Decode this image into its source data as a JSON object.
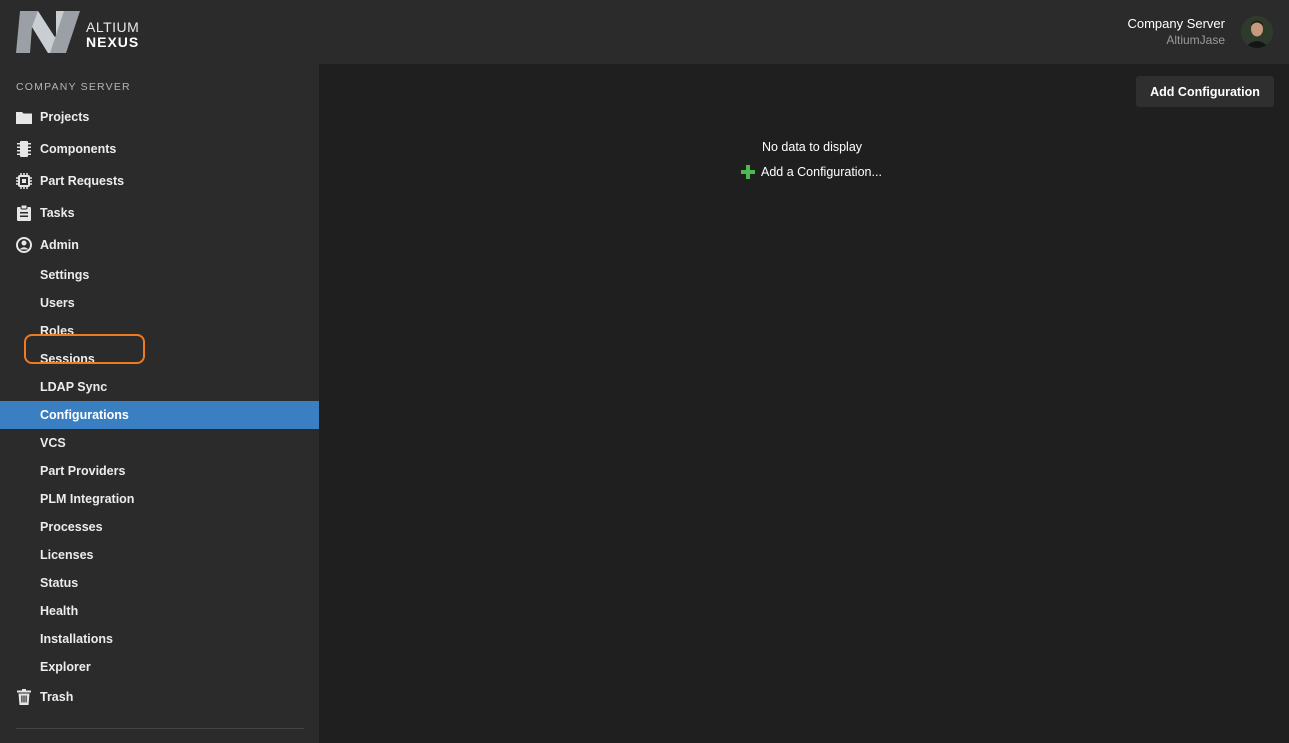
{
  "header": {
    "logo_line1": "ALTIUM",
    "logo_line2": "NEXUS",
    "server_name": "Company Server",
    "user_name": "AltiumJase"
  },
  "sidebar": {
    "section_label": "COMPANY SERVER",
    "items": [
      {
        "label": "Projects",
        "icon": "folder-icon"
      },
      {
        "label": "Components",
        "icon": "component-icon"
      },
      {
        "label": "Part Requests",
        "icon": "chip-icon"
      },
      {
        "label": "Tasks",
        "icon": "clipboard-icon"
      },
      {
        "label": "Admin",
        "icon": "user-circle-icon"
      },
      {
        "label": "Settings"
      },
      {
        "label": "Users"
      },
      {
        "label": "Roles"
      },
      {
        "label": "Sessions"
      },
      {
        "label": "LDAP Sync"
      },
      {
        "label": "Configurations",
        "active": true
      },
      {
        "label": "VCS"
      },
      {
        "label": "Part Providers"
      },
      {
        "label": "PLM Integration"
      },
      {
        "label": "Processes"
      },
      {
        "label": "Licenses"
      },
      {
        "label": "Status"
      },
      {
        "label": "Health"
      },
      {
        "label": "Installations"
      },
      {
        "label": "Explorer"
      },
      {
        "label": "Trash",
        "icon": "trash-icon"
      }
    ]
  },
  "main": {
    "add_button_label": "Add Configuration",
    "empty_message": "No data to display",
    "add_link_label": "Add a Configuration..."
  },
  "colors": {
    "accent": "#3a7fc1",
    "highlight": "#f07a1f",
    "add_icon": "#4cbb4c"
  }
}
